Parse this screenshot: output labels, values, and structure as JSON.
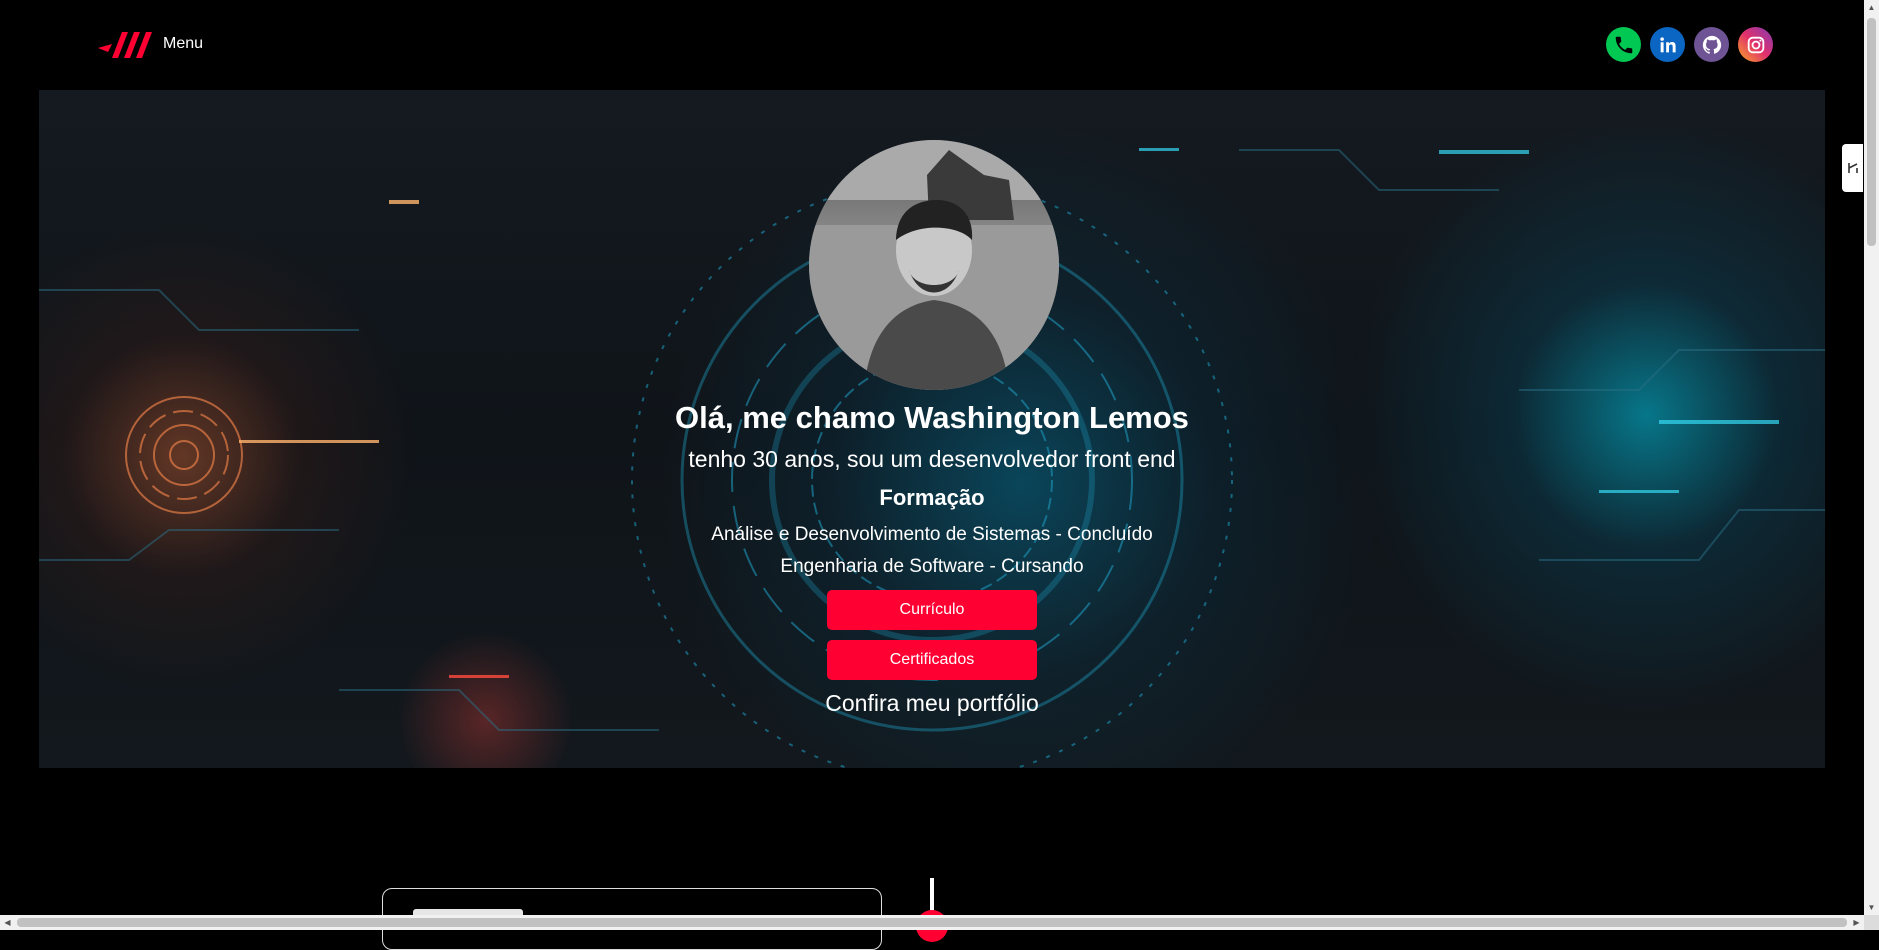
{
  "header": {
    "menu_label": "Menu",
    "logo_icon": "slashes-logo-icon",
    "socials": [
      {
        "name": "phone-icon",
        "color": "#00c853"
      },
      {
        "name": "linkedin-icon",
        "color": "#0a66c2"
      },
      {
        "name": "github-icon",
        "color": "#6e5494"
      },
      {
        "name": "instagram-icon",
        "color": "#e1306c"
      }
    ]
  },
  "hero": {
    "greeting": "Olá, me chamo Washington Lemos",
    "tagline": "tenho 30 anos, sou um desenvolvedor front end",
    "education_title": "Formação",
    "education": [
      "Análise e Desenvolvimento de Sistemas - Concluído",
      "Engenharia de Software - Cursando"
    ],
    "buttons": {
      "resume": "Currículo",
      "certificates": "Certificados"
    },
    "portfolio_text": "Confira meu portfólio"
  },
  "colors": {
    "accent": "#ff0032",
    "background": "#000000"
  }
}
